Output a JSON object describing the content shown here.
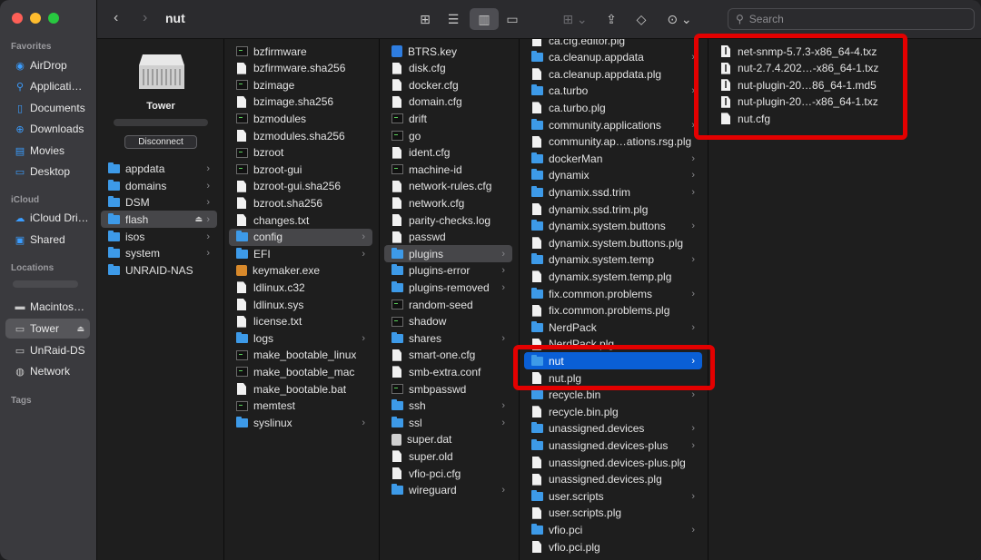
{
  "window": {
    "title": "nut",
    "search_placeholder": "Search"
  },
  "sidebar": {
    "favorites_header": "Favorites",
    "favorites": [
      "AirDrop",
      "Applicati…",
      "Documents",
      "Downloads",
      "Movies",
      "Desktop"
    ],
    "icloud_header": "iCloud",
    "icloud": [
      "iCloud Dri…",
      "Shared"
    ],
    "locations_header": "Locations",
    "locations": [
      "Macintos…",
      "Tower",
      "UnRaid-DS",
      "Network"
    ],
    "tags_header": "Tags"
  },
  "server": {
    "name": "Tower",
    "disconnect_label": "Disconnect",
    "shares": [
      "appdata",
      "domains",
      "DSM",
      "flash",
      "isos",
      "system",
      "UNRAID-NAS"
    ]
  },
  "flash_column": [
    "bzfirmware",
    "bzfirmware.sha256",
    "bzimage",
    "bzimage.sha256",
    "bzmodules",
    "bzmodules.sha256",
    "bzroot",
    "bzroot-gui",
    "bzroot-gui.sha256",
    "bzroot.sha256",
    "changes.txt",
    "config",
    "EFI",
    "keymaker.exe",
    "ldlinux.c32",
    "ldlinux.sys",
    "license.txt",
    "logs",
    "make_bootable_linux",
    "make_bootable_mac",
    "make_bootable.bat",
    "memtest",
    "syslinux"
  ],
  "config_column": [
    "BTRS.key",
    "disk.cfg",
    "docker.cfg",
    "domain.cfg",
    "drift",
    "go",
    "ident.cfg",
    "machine-id",
    "network-rules.cfg",
    "network.cfg",
    "parity-checks.log",
    "passwd",
    "plugins",
    "plugins-error",
    "plugins-removed",
    "random-seed",
    "shadow",
    "shares",
    "smart-one.cfg",
    "smb-extra.conf",
    "smbpasswd",
    "ssh",
    "ssl",
    "super.dat",
    "super.old",
    "vfio-pci.cfg",
    "wireguard"
  ],
  "plugins_column": [
    "ca.cfg.editor.plg",
    "ca.cleanup.appdata",
    "ca.cleanup.appdata.plg",
    "ca.turbo",
    "ca.turbo.plg",
    "community.applications",
    "community.ap…ations.rsg.plg",
    "dockerMan",
    "dynamix",
    "dynamix.ssd.trim",
    "dynamix.ssd.trim.plg",
    "dynamix.system.buttons",
    "dynamix.system.buttons.plg",
    "dynamix.system.temp",
    "dynamix.system.temp.plg",
    "fix.common.problems",
    "fix.common.problems.plg",
    "NerdPack",
    "NerdPack.plg",
    "nut",
    "nut.plg",
    "recycle.bin",
    "recycle.bin.plg",
    "unassigned.devices",
    "unassigned.devices-plus",
    "unassigned.devices-plus.plg",
    "unassigned.devices.plg",
    "user.scripts",
    "user.scripts.plg",
    "vfio.pci",
    "vfio.pci.plg"
  ],
  "nut_column": [
    "net-snmp-5.7.3-x86_64-4.txz",
    "nut-2.7.4.202…-x86_64-1.txz",
    "nut-plugin-20…86_64-1.md5",
    "nut-plugin-20…-x86_64-1.txz",
    "nut.cfg"
  ],
  "colors": {
    "selection": "#0a5fd6",
    "folder": "#3d9ae8",
    "highlight_box": "#e30000"
  }
}
